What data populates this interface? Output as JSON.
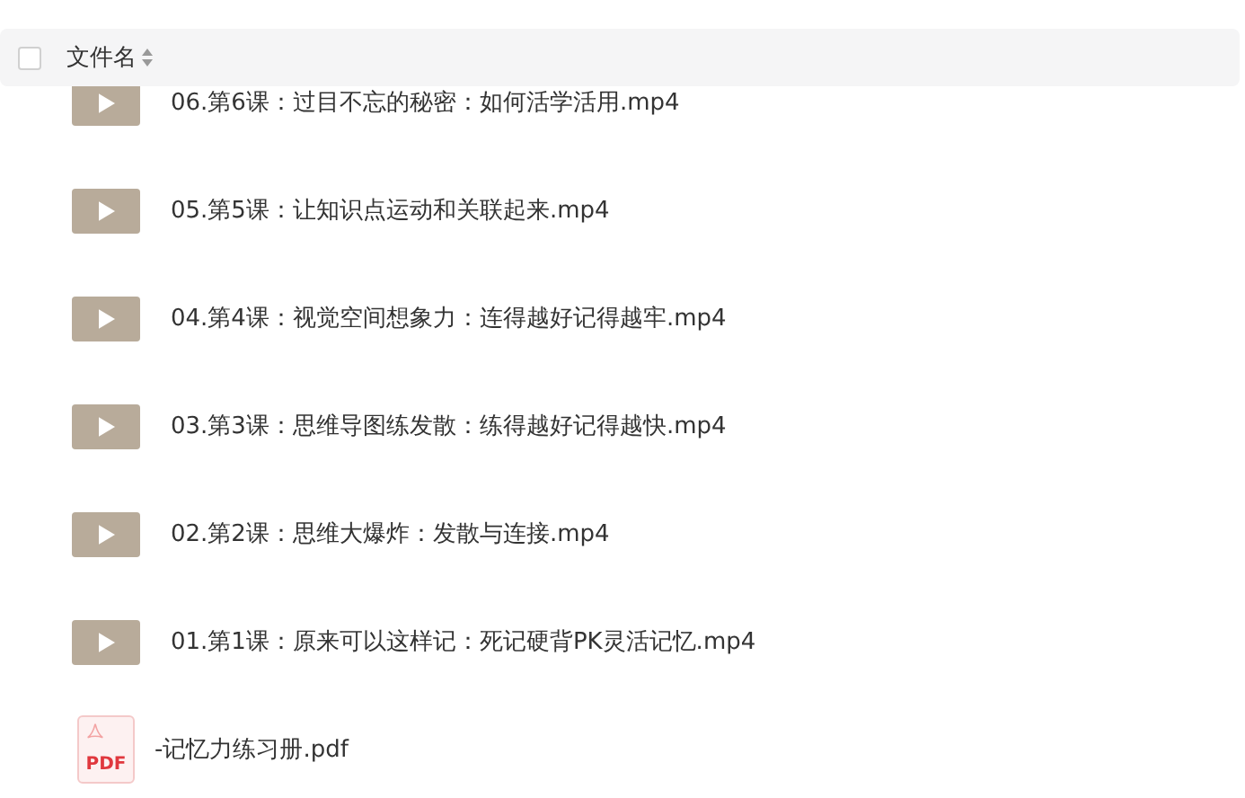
{
  "header": {
    "checked": false,
    "column_label": "文件名"
  },
  "files": [
    {
      "kind": "video",
      "name": "06.第6课：过目不忘的秘密：如何活学活用.mp4"
    },
    {
      "kind": "video",
      "name": "05.第5课：让知识点运动和关联起来.mp4"
    },
    {
      "kind": "video",
      "name": "04.第4课：视觉空间想象力：连得越好记得越牢.mp4"
    },
    {
      "kind": "video",
      "name": "03.第3课：思维导图练发散：练得越好记得越快.mp4"
    },
    {
      "kind": "video",
      "name": "02.第2课：思维大爆炸：发散与连接.mp4"
    },
    {
      "kind": "video",
      "name": "01.第1课：原来可以这样记：死记硬背PK灵活记忆.mp4"
    },
    {
      "kind": "pdf",
      "name": "-记忆力练习册.pdf",
      "badge": "PDF"
    }
  ]
}
